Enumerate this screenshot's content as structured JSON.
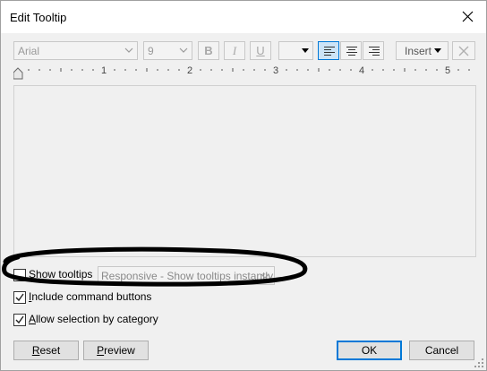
{
  "window": {
    "title": "Edit Tooltip",
    "close_icon": "close-icon"
  },
  "toolbar": {
    "font_value": "Arial",
    "size_value": "9",
    "bold_label": "B",
    "italic_label": "I",
    "underline_label": "U",
    "color_value": "",
    "align_left_icon": "align-left-icon",
    "align_center_icon": "align-center-icon",
    "align_right_icon": "align-right-icon",
    "insert_label": "Insert",
    "clear_icon": "clear-icon"
  },
  "ruler": {
    "numbers": [
      "1",
      "2",
      "3",
      "4",
      "5"
    ]
  },
  "options": {
    "show_tooltips": {
      "label": "Show tooltips",
      "checked": false
    },
    "tooltip_mode": "Responsive - Show tooltips instantly",
    "include_command_buttons": {
      "label": "Include command buttons",
      "checked": true
    },
    "allow_selection": {
      "label": "Allow selection by category",
      "checked": true
    }
  },
  "buttons": {
    "reset": "Reset",
    "preview": "Preview",
    "ok": "OK",
    "cancel": "Cancel"
  },
  "colors": {
    "accent": "#0078d7",
    "dialog_bg": "#f0f0f0",
    "annotation_ellipse": "#000000"
  }
}
